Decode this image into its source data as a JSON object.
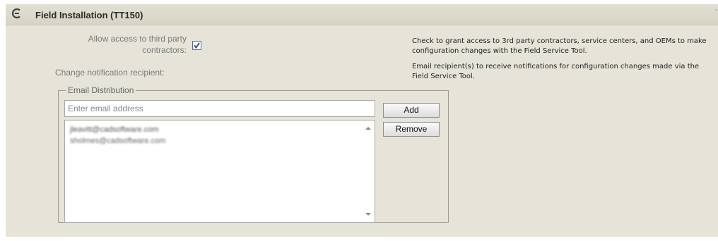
{
  "panel": {
    "title": "Field Installation (TT150)",
    "corner_mark": "'"
  },
  "form": {
    "access_label": "Allow access to third party contractors:",
    "access_checked": true,
    "notify_label": "Change notification recipient:"
  },
  "help": {
    "access_text": "Check to grant access to 3rd party contractors, service centers, and OEMs to make configuration changes with the Field Service Tool.",
    "notify_text": "Email recipient(s) to receive notifications for configuration changes made via the Field Service Tool."
  },
  "email_distribution": {
    "legend": "Email Distribution",
    "input_placeholder": "Enter email address",
    "add_label": "Add",
    "remove_label": "Remove",
    "recipients": [
      "jleavitt@cadsoftware.com",
      "sholmes@cadsoftware.com"
    ]
  },
  "icons": {
    "collapse": "collapse-minus-icon",
    "check": "checkmark-icon",
    "scroll_up": "scroll-up-arrow-icon",
    "scroll_down": "scroll-down-arrow-icon"
  },
  "colors": {
    "panel_background": "#e6e4d8",
    "header_background": "#d6d4c4",
    "checkbox_border": "#5a6c8c",
    "checkmark": "#2b3f8f"
  }
}
